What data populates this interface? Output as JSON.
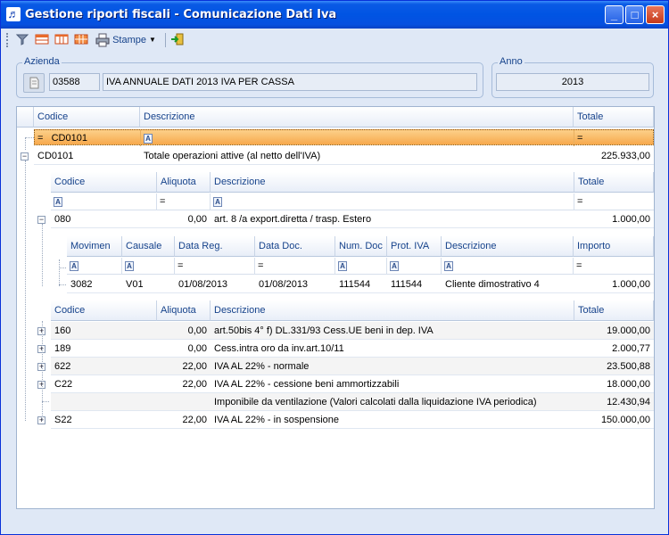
{
  "window": {
    "title": "Gestione riporti fiscali - Comunicazione Dati Iva",
    "min_label": "_",
    "max_label": "□",
    "close_label": "×"
  },
  "toolbar": {
    "stampe_label": "Stampe"
  },
  "azienda": {
    "legend": "Azienda",
    "code": "03588",
    "description": "IVA ANNUALE DATI 2013 IVA PER CASSA"
  },
  "anno": {
    "legend": "Anno",
    "value": "2013"
  },
  "grid": {
    "columns": {
      "codice": "Codice",
      "descrizione": "Descrizione",
      "totale": "Totale"
    },
    "filter": {
      "codice": "CD0101",
      "op": "="
    },
    "row": {
      "codice": "CD0101",
      "descrizione": "Totale operazioni attive (al netto dell'IVA)",
      "totale": "225.933,00"
    }
  },
  "sub1": {
    "columns": {
      "codice": "Codice",
      "aliquota": "Aliquota",
      "descrizione": "Descrizione",
      "totale": "Totale"
    },
    "filter_op": "=",
    "row": {
      "codice": "080",
      "aliquota": "0,00",
      "descrizione": "art. 8 /a export.diretta / trasp. Estero",
      "totale": "1.000,00"
    }
  },
  "sub2": {
    "columns": {
      "movimen": "Movimen",
      "causale": "Causale",
      "data_reg": "Data Reg.",
      "data_doc": "Data Doc.",
      "num_doc": "Num. Doc",
      "prot_iva": "Prot. IVA",
      "descrizione": "Descrizione",
      "importo": "Importo"
    },
    "filter_op": "=",
    "row": {
      "movimen": "3082",
      "causale": "V01",
      "data_reg": "01/08/2013",
      "data_doc": "01/08/2013",
      "num_doc": "111544",
      "prot_iva": "111544",
      "descrizione": "Cliente dimostrativo 4",
      "importo": "1.000,00"
    }
  },
  "sub3": {
    "columns": {
      "codice": "Codice",
      "aliquota": "Aliquota",
      "descrizione": "Descrizione",
      "totale": "Totale"
    },
    "rows": [
      {
        "codice": "160",
        "aliquota": "0,00",
        "descrizione": "art.50bis 4° f) DL.331/93 Cess.UE beni in dep. IVA",
        "totale": "19.000,00"
      },
      {
        "codice": "189",
        "aliquota": "0,00",
        "descrizione": "Cess.intra oro da inv.art.10/11",
        "totale": "2.000,77"
      },
      {
        "codice": "622",
        "aliquota": "22,00",
        "descrizione": "IVA AL 22% - normale",
        "totale": "23.500,88"
      },
      {
        "codice": "C22",
        "aliquota": "22,00",
        "descrizione": "IVA AL 22% - cessione beni ammortizzabili",
        "totale": "18.000,00"
      },
      {
        "codice": "",
        "aliquota": "",
        "descrizione": "Imponibile da ventilazione (Valori calcolati dalla liquidazione IVA periodica)",
        "totale": "12.430,94"
      },
      {
        "codice": "S22",
        "aliquota": "22,00",
        "descrizione": "IVA AL 22% - in sospensione",
        "totale": "150.000,00"
      }
    ]
  }
}
